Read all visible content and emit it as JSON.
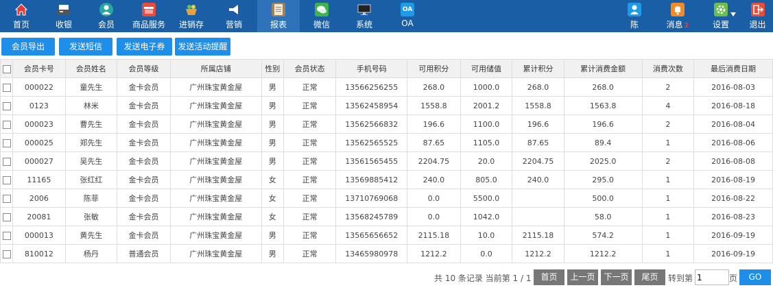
{
  "nav": {
    "home": "首页",
    "cashier": "收银",
    "member": "会员",
    "goods": "商品服务",
    "inventory": "进销存",
    "marketing": "营销",
    "report": "报表",
    "wechat": "微信",
    "system": "系统",
    "oa": "OA",
    "oa_icon_text": "OA",
    "user": "陈",
    "messages": "消息",
    "message_count": "2",
    "settings": "设置",
    "logout": "退出"
  },
  "actions": {
    "export": "会员导出",
    "sms": "发送短信",
    "coupon": "发送电子券",
    "reminder": "发送活动提醒"
  },
  "table": {
    "headers": [
      "会员卡号",
      "会员姓名",
      "会员等级",
      "所属店铺",
      "性别",
      "会员状态",
      "手机号码",
      "可用积分",
      "可用储值",
      "累计积分",
      "累计消费金额",
      "消费次数",
      "最后消费日期"
    ],
    "rows": [
      [
        "000022",
        "童先生",
        "金卡会员",
        "广州珠宝黄金屋",
        "男",
        "正常",
        "13566256255",
        "268.0",
        "1000.0",
        "268.0",
        "268.0",
        "2",
        "2016-08-03"
      ],
      [
        "0123",
        "林米",
        "金卡会员",
        "广州珠宝黄金屋",
        "男",
        "正常",
        "13562458954",
        "1558.8",
        "2001.2",
        "1558.8",
        "1563.8",
        "4",
        "2016-08-18"
      ],
      [
        "000023",
        "曹先生",
        "金卡会员",
        "广州珠宝黄金屋",
        "男",
        "正常",
        "13562566832",
        "196.6",
        "1100.0",
        "196.6",
        "196.6",
        "2",
        "2016-08-04"
      ],
      [
        "000025",
        "郑先生",
        "金卡会员",
        "广州珠宝黄金屋",
        "男",
        "正常",
        "13562565525",
        "87.65",
        "1105.0",
        "87.65",
        "89.4",
        "1",
        "2016-08-06"
      ],
      [
        "000027",
        "吴先生",
        "金卡会员",
        "广州珠宝黄金屋",
        "男",
        "正常",
        "13561565455",
        "2204.75",
        "20.0",
        "2204.75",
        "2025.0",
        "2",
        "2016-08-08"
      ],
      [
        "11165",
        "张红红",
        "金卡会员",
        "广州珠宝黄金屋",
        "女",
        "正常",
        "13569885412",
        "240.0",
        "805.0",
        "240.0",
        "295.0",
        "1",
        "2016-08-19"
      ],
      [
        "2006",
        "陈菲",
        "金卡会员",
        "广州珠宝黄金屋",
        "女",
        "正常",
        "13710769068",
        "0.0",
        "5500.0",
        "",
        "500.0",
        "1",
        "2016-08-22"
      ],
      [
        "20081",
        "张敏",
        "金卡会员",
        "广州珠宝黄金屋",
        "女",
        "正常",
        "13568245789",
        "0.0",
        "1042.0",
        "",
        "58.0",
        "1",
        "2016-08-23"
      ],
      [
        "000013",
        "黄先生",
        "金卡会员",
        "广州珠宝黄金屋",
        "男",
        "正常",
        "13565656652",
        "2115.18",
        "10.0",
        "2115.18",
        "574.2",
        "1",
        "2016-09-19"
      ],
      [
        "810012",
        "杨丹",
        "普通会员",
        "广州珠宝黄金屋",
        "男",
        "正常",
        "13465980978",
        "1212.2",
        "0.0",
        "1212.2",
        "1212.2",
        "1",
        "2016-09-19"
      ]
    ]
  },
  "pager": {
    "summary": "共 10 条记录 当前第 1 / 1",
    "first": "首页",
    "prev": "上一页",
    "next": "下一页",
    "last": "尾页",
    "goto_label": "转到第",
    "page_value": "1",
    "page_suffix": "页",
    "go": "GO"
  }
}
